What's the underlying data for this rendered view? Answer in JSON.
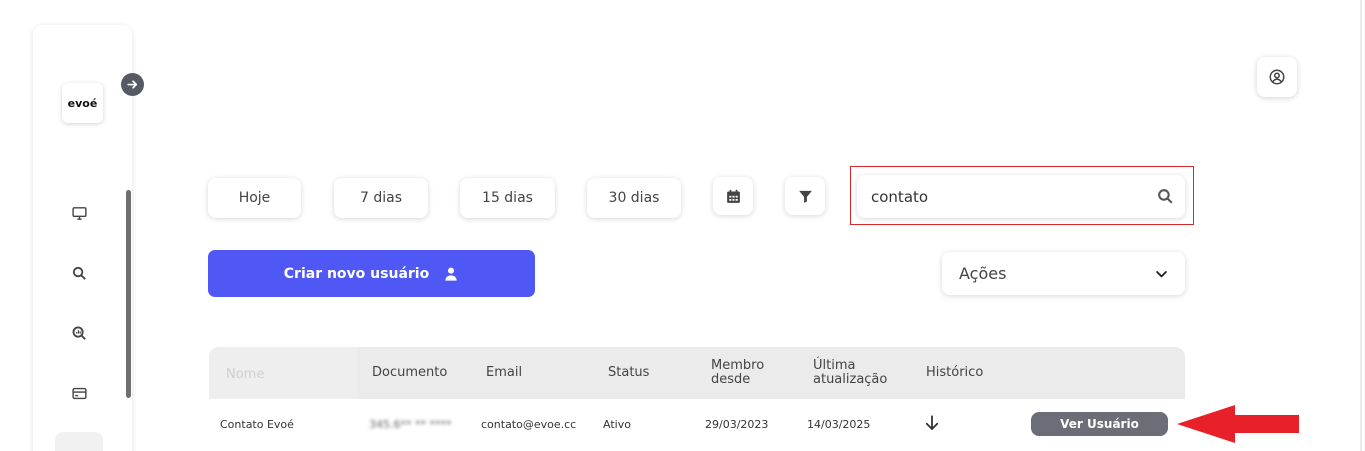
{
  "app": {
    "logo_text": "evoé"
  },
  "sidebar": {
    "items": [
      {
        "icon": "monitor-icon"
      },
      {
        "icon": "search-icon"
      },
      {
        "icon": "search-chart-icon"
      },
      {
        "icon": "credit-card-icon"
      }
    ]
  },
  "filters": {
    "today": "Hoje",
    "days7": "7 dias",
    "days15": "15 dias",
    "days30": "30 dias"
  },
  "search": {
    "value": "contato",
    "placeholder": ""
  },
  "actions": {
    "create_user": "Criar novo usuário",
    "dropdown_label": "Ações"
  },
  "table": {
    "headers": {
      "name": "Nome",
      "document": "Documento",
      "email": "Email",
      "status": "Status",
      "member_since": [
        "Membro",
        "desde"
      ],
      "last_update": [
        "Última",
        "atualização"
      ],
      "history": "Histórico"
    },
    "rows": [
      {
        "name": "Contato Evoé",
        "document": "345.6** ** ****",
        "email": "contato@evoe.cc",
        "status": "Ativo",
        "member_since": "29/03/2023",
        "last_update": "14/03/2025",
        "view_label": "Ver Usuário"
      }
    ]
  },
  "colors": {
    "primary": "#4f57f5",
    "highlight": "#d9262b",
    "arrow": "#e8202a",
    "view_button": "#6b6e76"
  }
}
